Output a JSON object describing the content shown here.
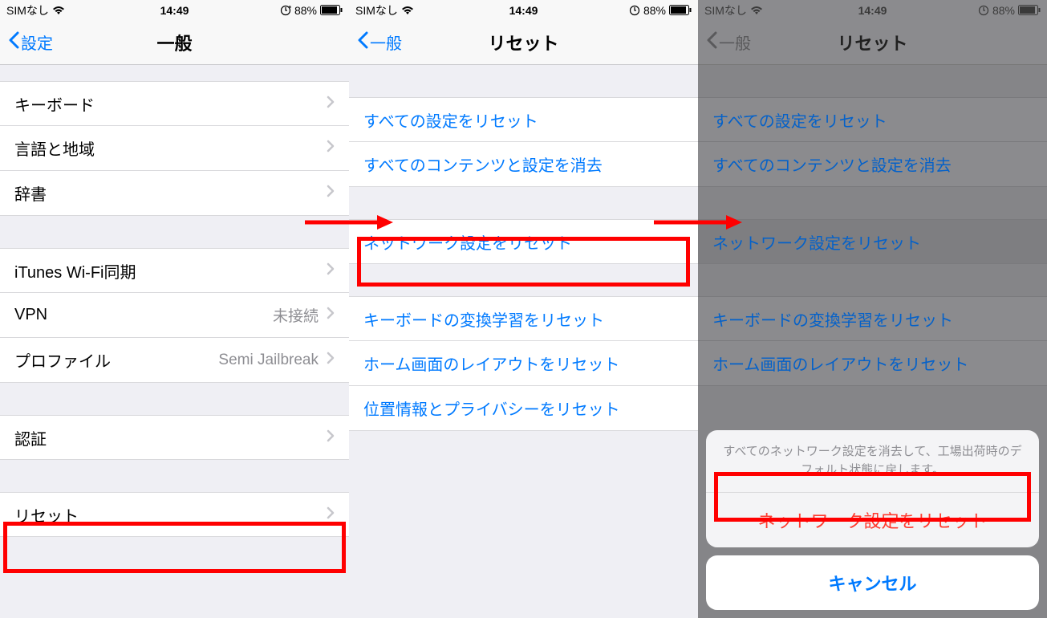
{
  "status": {
    "carrier": "SIMなし",
    "time": "14:49",
    "battery": "88%"
  },
  "screen1": {
    "back": "設定",
    "title": "一般",
    "rows": {
      "keyboard": "キーボード",
      "language": "言語と地域",
      "dictionary": "辞書",
      "itunes": "iTunes Wi-Fi同期",
      "vpn_label": "VPN",
      "vpn_value": "未接続",
      "profile_label": "プロファイル",
      "profile_value": "Semi Jailbreak",
      "cert": "認証",
      "reset": "リセット"
    }
  },
  "screen2": {
    "back": "一般",
    "title": "リセット",
    "rows": {
      "reset_all_settings": "すべての設定をリセット",
      "erase_all": "すべてのコンテンツと設定を消去",
      "reset_network": "ネットワーク設定をリセット",
      "reset_keyboard": "キーボードの変換学習をリセット",
      "reset_home": "ホーム画面のレイアウトをリセット",
      "reset_location": "位置情報とプライバシーをリセット"
    }
  },
  "screen3": {
    "back": "一般",
    "title": "リセット",
    "rows": {
      "reset_all_settings": "すべての設定をリセット",
      "erase_all": "すべてのコンテンツと設定を消去",
      "reset_network": "ネットワーク設定をリセット",
      "reset_keyboard": "キーボードの変換学習をリセット",
      "reset_home": "ホーム画面のレイアウトをリセット"
    },
    "sheet": {
      "message": "すべてのネットワーク設定を消去して、工場出荷時のデフォルト状態に戻します。",
      "confirm": "ネットワーク設定をリセット",
      "cancel": "キャンセル"
    }
  }
}
